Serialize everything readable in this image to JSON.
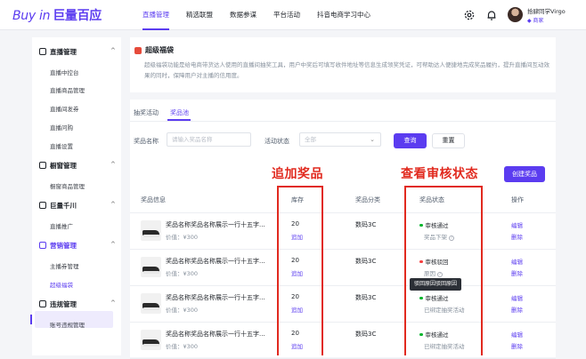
{
  "topbar": {
    "logo_text": "Buy in",
    "logo_cn": "巨量百应",
    "nav": [
      "直播管理",
      "精选联盟",
      "数据参谋",
      "平台活动",
      "抖音电商学习中心"
    ],
    "user_name": "拾肆同学Virgo",
    "user_badge": "◆ 商家"
  },
  "sidebar": {
    "sections": [
      {
        "label": "直播管理",
        "items": [
          "直播中控台",
          "直播商品管理",
          "直播间发券",
          "直播问购",
          "直播设置"
        ]
      },
      {
        "label": "橱窗管理",
        "items": [
          "橱窗商品管理"
        ]
      },
      {
        "label": "巨量千川",
        "items": [
          "直播推广"
        ]
      },
      {
        "label": "营销管理",
        "items": [
          "主播券管理",
          "超级福袋"
        ]
      },
      {
        "label": "违规管理",
        "items": [
          "账号违规管理"
        ]
      }
    ]
  },
  "page": {
    "title": "超级福袋",
    "description": "超级福袋功能是给电商带货达人使用的直播间抽奖工具，用户中奖后可填写收件地址等信息生成领奖凭证，可帮助达人便捷地完成奖品履约，提升直播间互动效果的同时，保障用户对主播的信用度。"
  },
  "tabs": [
    "抽奖活动",
    "奖品池"
  ],
  "filters": {
    "name_label": "奖品名称",
    "name_placeholder": "请输入奖品名称",
    "status_label": "活动状态",
    "status_value": "全部",
    "search_label": "查询",
    "reset_label": "重置"
  },
  "create_label": "创建奖品",
  "table": {
    "headers": [
      "奖品信息",
      "库存",
      "奖品分类",
      "奖品状态",
      "操作"
    ],
    "rows": [
      {
        "name": "奖品名称奖品名称展示一行十五字...",
        "price": "价值：¥300",
        "stock": "20",
        "add": "追加",
        "category": "数码3C",
        "status": "审核通过",
        "status_color": "#00b42a",
        "sub": "奖品下架",
        "sub_q": "?",
        "edit": "编辑",
        "del": "删除"
      },
      {
        "name": "奖品名称奖品名称展示一行十五字...",
        "price": "价值：¥300",
        "stock": "20",
        "add": "追加",
        "category": "数码3C",
        "status": "审核驳回",
        "status_color": "#f53f3f",
        "sub": "原因",
        "sub_q": "?",
        "edit": "编辑",
        "del": "删除"
      },
      {
        "name": "奖品名称奖品名称展示一行十五字...",
        "price": "价值：¥300",
        "stock": "20",
        "add": "追加",
        "category": "数码3C",
        "status": "审核通过",
        "status_color": "#00b42a",
        "sub": "已绑定抽奖活动",
        "sub_q": "",
        "edit": "编辑",
        "del": "删除"
      },
      {
        "name": "奖品名称奖品名称展示一行十五字...",
        "price": "价值：¥300",
        "stock": "20",
        "add": "追加",
        "category": "数码3C",
        "status": "审核通过",
        "status_color": "#00b42a",
        "sub": "已绑定抽奖活动",
        "sub_q": "",
        "edit": "编辑",
        "del": "删除"
      }
    ]
  },
  "tooltip": "驳回原因驳回原因",
  "annotations": {
    "left": "追加奖品",
    "right": "查看审核状态",
    "color": "#e12a1f"
  },
  "colors": {
    "accent": "#5b3cf0"
  },
  "icons": [
    "gear-icon",
    "bell-icon",
    "gift-icon"
  ]
}
